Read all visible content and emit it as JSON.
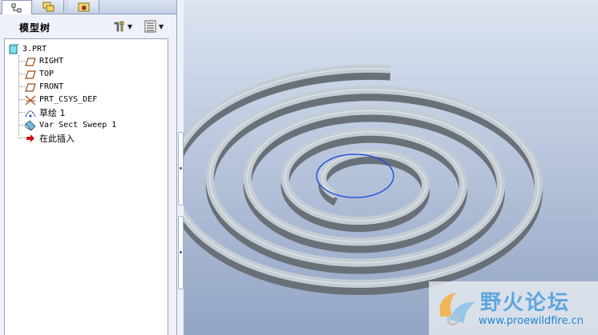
{
  "model_tree": {
    "title": "模型树",
    "items": [
      {
        "label": "3.PRT",
        "icon": "part-icon"
      },
      {
        "label": "RIGHT",
        "icon": "datum-plane-icon"
      },
      {
        "label": "TOP",
        "icon": "datum-plane-icon"
      },
      {
        "label": "FRONT",
        "icon": "datum-plane-icon"
      },
      {
        "label": "PRT_CSYS_DEF",
        "icon": "csys-icon"
      },
      {
        "label": "草绘 1",
        "icon": "sketch-icon"
      },
      {
        "label": "Var Sect Sweep 1",
        "icon": "sweep-icon"
      },
      {
        "label": "在此插入",
        "icon": "insert-here-arrow-icon"
      }
    ]
  },
  "tabs": [
    "model-tree-tab",
    "layers-tab",
    "favorites-tab"
  ],
  "watermark": {
    "title": "野火论坛",
    "url": "www.proewildfire.cn"
  },
  "colors": {
    "viewport_top": "#dde4f1",
    "viewport_bottom": "#93a5c4",
    "spiral_top": "#c4ccd4",
    "spiral_wall": "#6a7078",
    "sketch_curve": "#1f4fe0",
    "insert_arrow": "#d01010"
  }
}
